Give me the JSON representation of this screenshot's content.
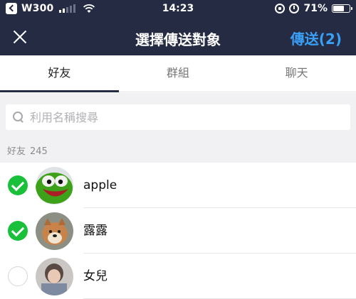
{
  "status_bar": {
    "carrier": "W300",
    "time": "14:23",
    "battery_percent": "71%",
    "battery_level": 0.71,
    "signal_bars": 2
  },
  "header": {
    "title": "選擇傳送對象",
    "send_label": "傳送(2)",
    "close_icon": "close-icon"
  },
  "tabs": [
    {
      "label": "好友",
      "active": true
    },
    {
      "label": "群組",
      "active": false
    },
    {
      "label": "聊天",
      "active": false
    }
  ],
  "search": {
    "placeholder": "利用名稱搜尋",
    "value": ""
  },
  "section": {
    "title": "好友",
    "count": "245"
  },
  "friends": [
    {
      "name": "apple",
      "selected": true
    },
    {
      "name": "露露",
      "selected": true
    },
    {
      "name": "女兒",
      "selected": false
    }
  ],
  "colors": {
    "header_bg": "#242b43",
    "accent_blue": "#3aa0f5",
    "check_green": "#19c03a"
  }
}
